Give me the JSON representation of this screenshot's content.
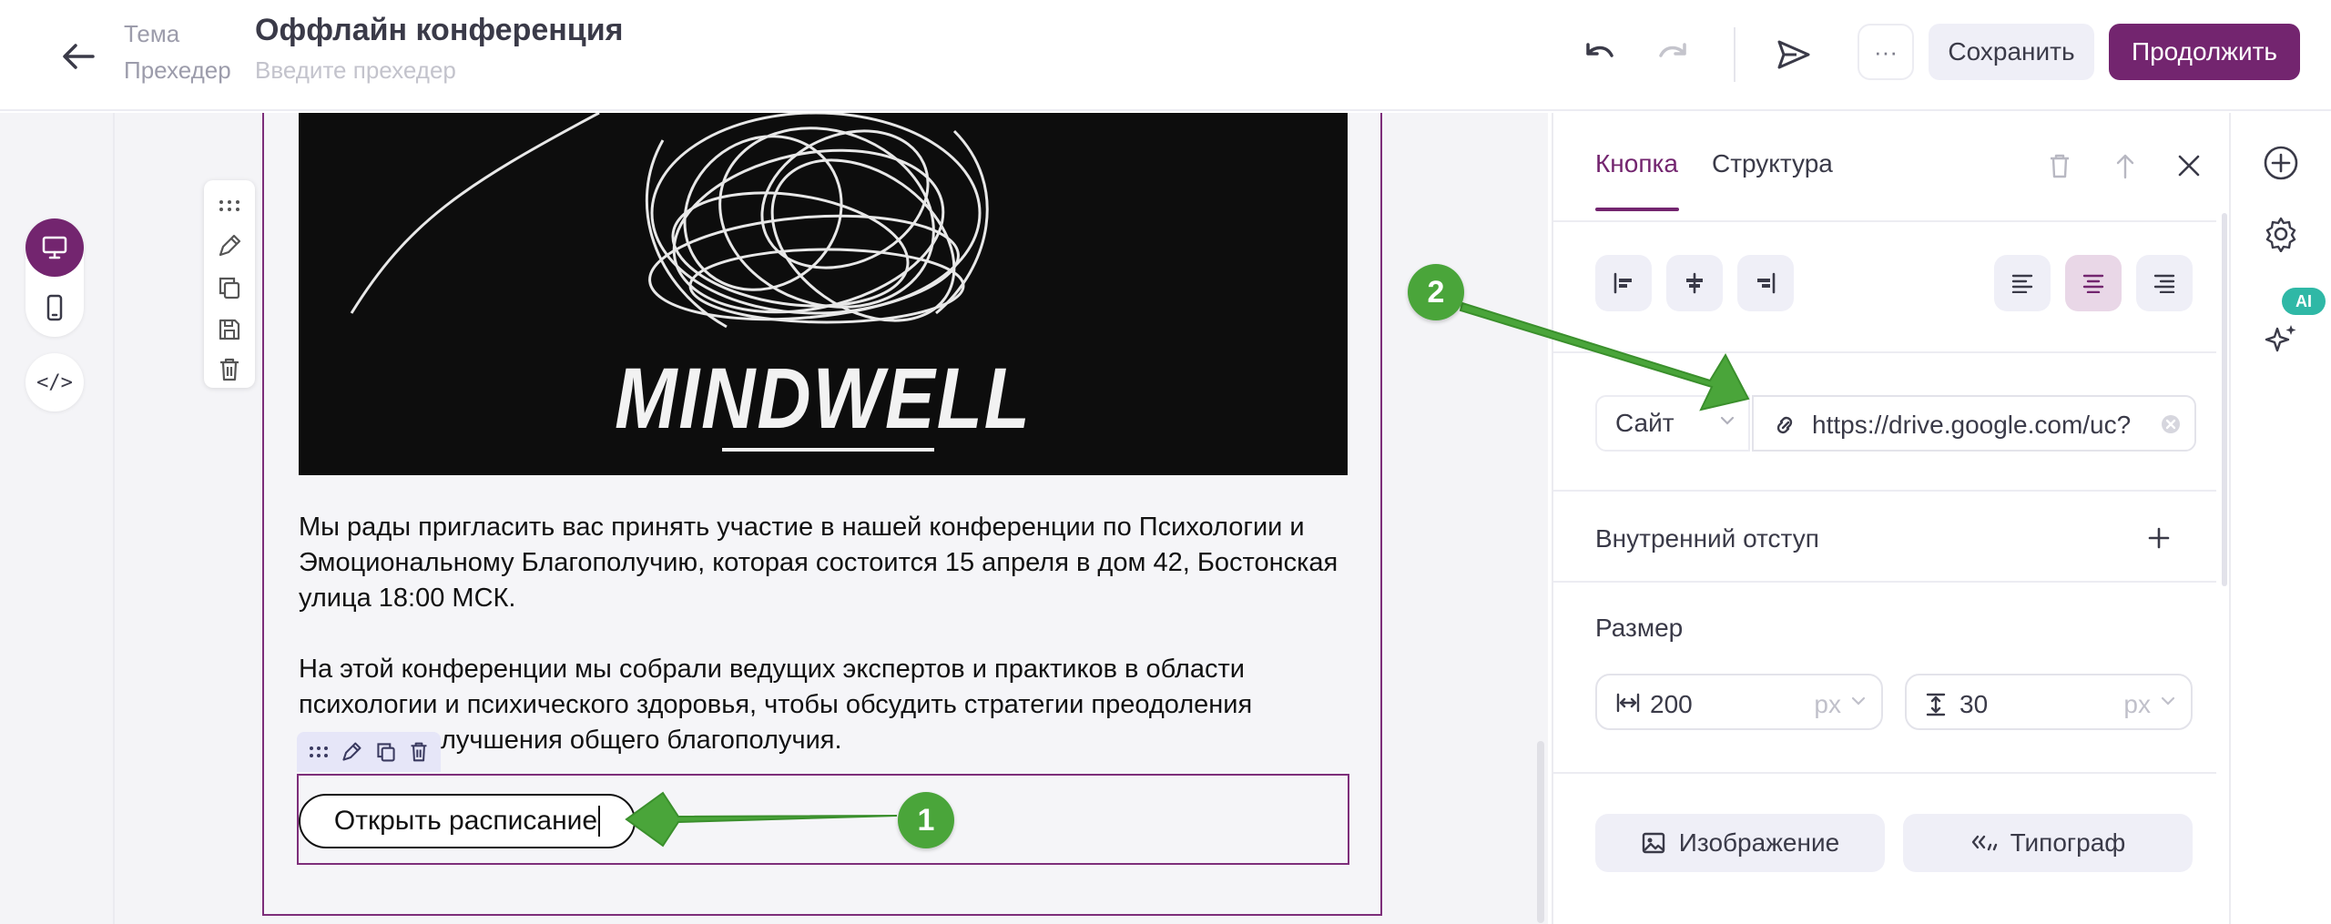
{
  "header": {
    "subject_label": "Тема",
    "subject_value": "Оффлайн конференция",
    "preheader_label": "Прехедер",
    "preheader_placeholder": "Введите прехедер",
    "more_label": "···",
    "save_label": "Сохранить",
    "continue_label": "Продолжить"
  },
  "email": {
    "image_text": "MINDWELL",
    "paragraph1": "Мы рады пригласить вас принять участие в нашей конференции по Психологии и Эмоциональному Благополучию, которая состоится 15 апреля в дом 42, Бостонская улица 18:00 МСК.",
    "paragraph2_line1": "На этой конференции мы собрали ведущих экспертов и практиков в области",
    "paragraph2_line2": "психологии и психического здоровья, чтобы обсудить стратегии преодоления",
    "paragraph2_line3": "лучшения общего благополучия.",
    "button_text": "Открыть расписание"
  },
  "left_rail": {
    "code_label": "</>"
  },
  "settings": {
    "tab_button": "Кнопка",
    "tab_structure": "Структура",
    "link_type": "Сайт",
    "link_url": "https://drive.google.com/uc?",
    "padding_label": "Внутренний отступ",
    "size_label": "Размер",
    "width_value": "200",
    "height_value": "30",
    "unit": "px",
    "image_button": "Изображение",
    "typograph_button": "Типограф"
  },
  "right_rail": {
    "ai_badge": "AI"
  },
  "annotations": {
    "marker1": "1",
    "marker2": "2",
    "color": "#4aa53a"
  },
  "colors": {
    "brand": "#73256f",
    "brand_light": "#e9d7e7",
    "button_bg": "#efeff7"
  }
}
